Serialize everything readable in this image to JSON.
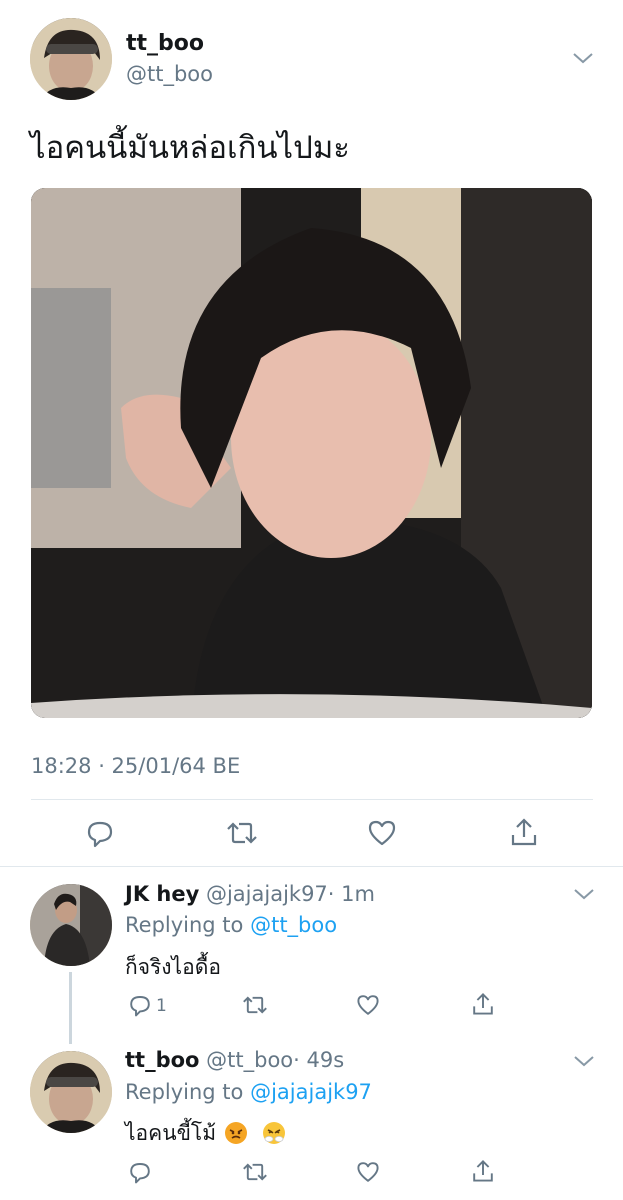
{
  "main_tweet": {
    "display_name": "tt_boo",
    "handle": "@tt_boo",
    "text": "ไอคนนี้มันหล่อเกินไปมะ",
    "timestamp": "18:28 · 25/01/64 BE",
    "actions": [
      "reply-icon",
      "retweet-icon",
      "like-icon",
      "share-icon"
    ]
  },
  "replies": [
    {
      "display_name": "JK hey",
      "handle": "@jajajajk97",
      "time": "· 1m",
      "replying_prefix": "Replying to",
      "replying_to": "@tt_boo",
      "text": "ก็จริงไอดื้อ",
      "reply_count": "1"
    },
    {
      "display_name": "tt_boo",
      "handle": "@tt_boo",
      "time": "· 49s",
      "replying_prefix": "Replying to",
      "replying_to": "@jajajajk97",
      "text": "ไอคนขี้โม้",
      "emojis": [
        "angry-face-emoji",
        "steam-nose-emoji"
      ]
    }
  ],
  "colors": {
    "link": "#1da1f2",
    "muted": "#657786",
    "divider": "#e1e8ed"
  }
}
